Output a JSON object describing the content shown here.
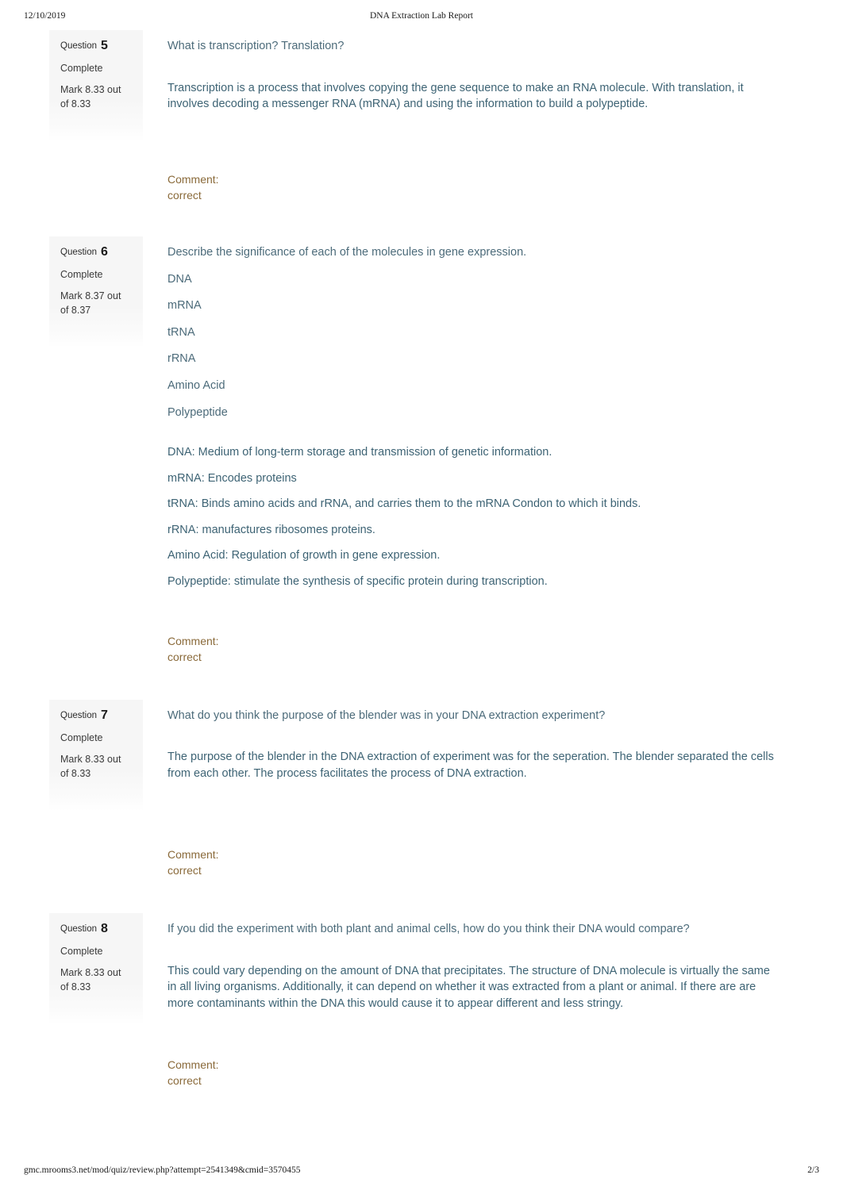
{
  "print_header": {
    "date": "12/10/2019",
    "title": "DNA Extraction Lab Report"
  },
  "print_footer": {
    "url": "gmc.mrooms3.net/mod/quiz/review.php?attempt=2541349&cmid=3570455",
    "page": "2/3"
  },
  "colors": {
    "question_text": "#4c6b7a",
    "answer_text": "#3d6374",
    "comment_text": "#8a6a3a",
    "info_panel_bg": "#f6f6f6",
    "page_bg": "#ffffff"
  },
  "questions": [
    {
      "label": "Question",
      "number": "5",
      "state": "Complete",
      "mark": "Mark 8.33 out of 8.33",
      "question_lines": [
        "What is transcription? Translation?"
      ],
      "answer_lines": [
        "Transcription is a process that involves copying the gene sequence to make an RNA molecule. With translation, it involves decoding a messenger RNA (mRNA) and using the information to build a polypeptide."
      ],
      "comment_label": "Comment:",
      "comment_value": "correct"
    },
    {
      "label": "Question",
      "number": "6",
      "state": "Complete",
      "mark": "Mark 8.37 out of 8.37",
      "question_lines": [
        "Describe the significance of each of the molecules in gene expression.",
        "DNA",
        "mRNA",
        "tRNA",
        "rRNA",
        "Amino Acid",
        "Polypeptide"
      ],
      "answer_lines": [
        "DNA: Medium of long-term storage and transmission of genetic information.",
        "mRNA: Encodes proteins",
        "tRNA: Binds amino acids and rRNA, and carries them to the mRNA Condon to which it binds.",
        "rRNA: manufactures ribosomes proteins.",
        "Amino Acid: Regulation of growth in gene expression.",
        "Polypeptide: stimulate the synthesis of specific protein during transcription."
      ],
      "comment_label": "Comment:",
      "comment_value": "correct"
    },
    {
      "label": "Question",
      "number": "7",
      "state": "Complete",
      "mark": "Mark 8.33 out of 8.33",
      "question_lines": [
        "What do you think the purpose of the blender was in your DNA extraction experiment?"
      ],
      "answer_lines": [
        "The purpose of the blender in the DNA extraction of experiment was for the seperation. The blender separated the cells from each other. The process facilitates the process of DNA extraction."
      ],
      "comment_label": "Comment:",
      "comment_value": "correct"
    },
    {
      "label": "Question",
      "number": "8",
      "state": "Complete",
      "mark": "Mark 8.33 out of 8.33",
      "question_lines": [
        "If you did the experiment with both plant and animal cells, how do you think their DNA would compare?"
      ],
      "answer_lines": [
        "This could vary depending on the amount of DNA that precipitates. The structure of DNA molecule is virtually the same in all living organisms. Additionally, it can depend on whether it was extracted from a plant or animal. If there are are more contaminants within the DNA this would cause it to appear different and less stringy."
      ],
      "comment_label": "Comment:",
      "comment_value": "correct"
    }
  ]
}
